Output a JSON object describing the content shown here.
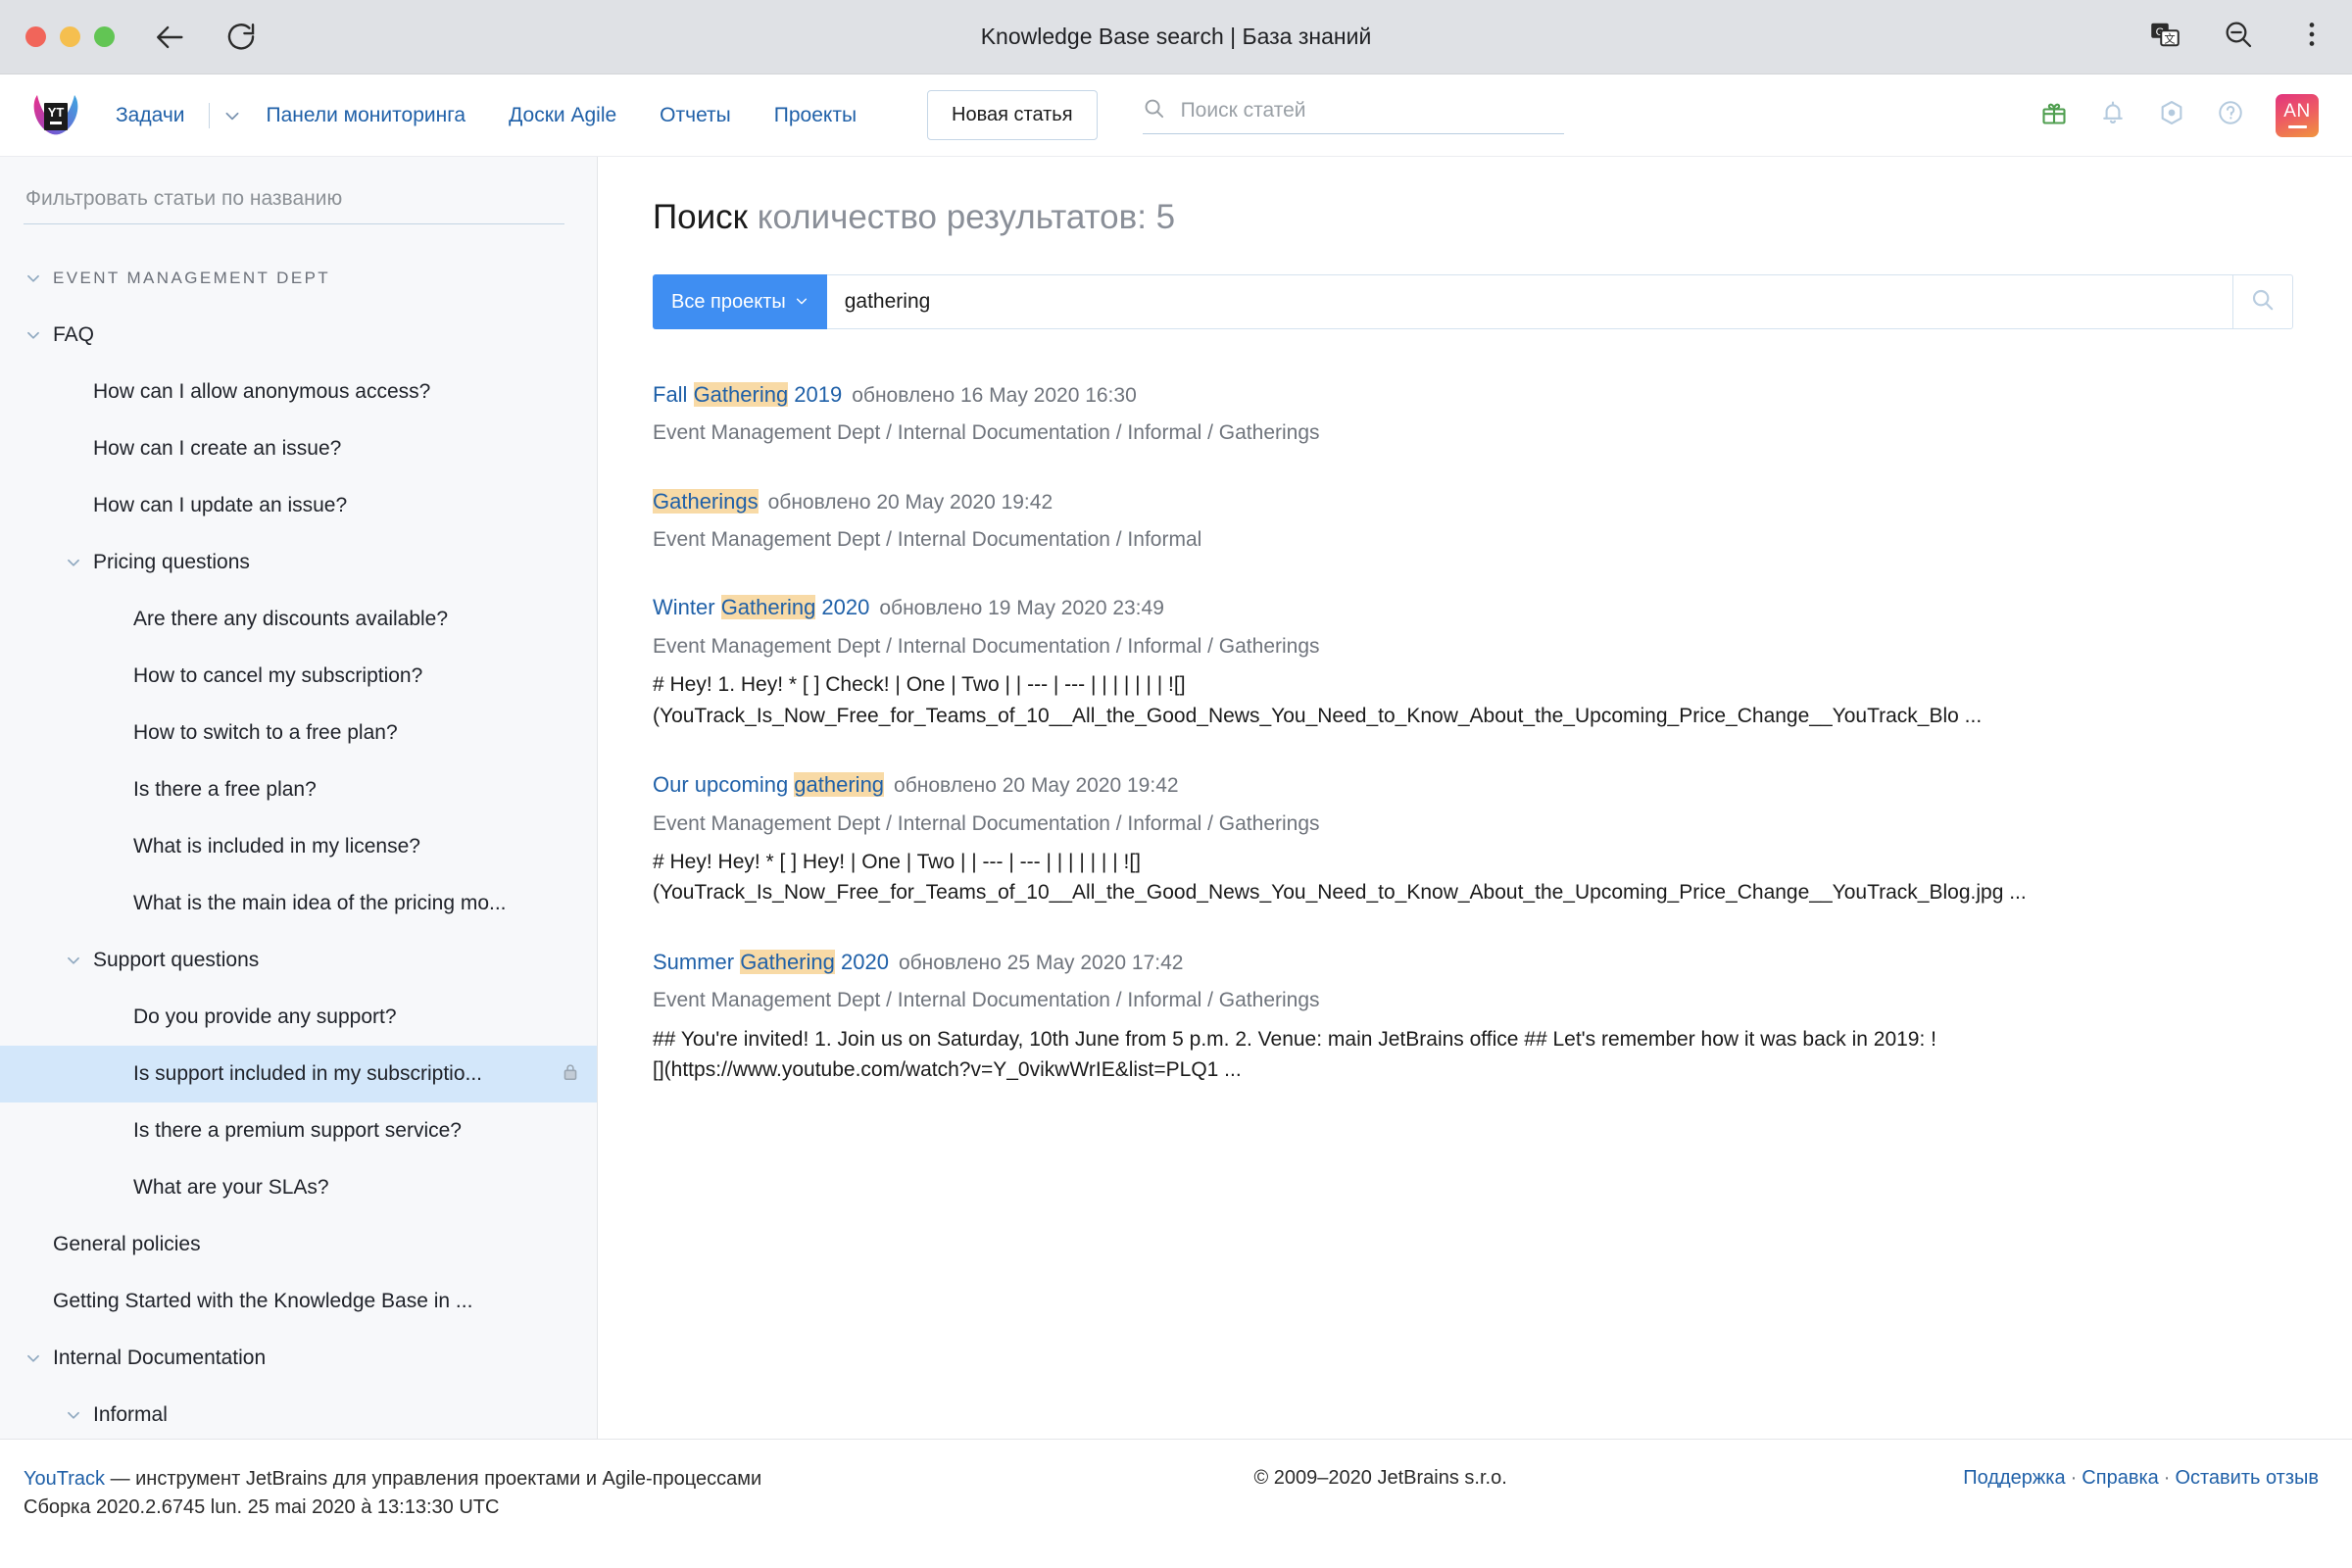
{
  "browser": {
    "page_title": "Knowledge Base search | База знаний",
    "back_icon": "back-arrow-icon",
    "reload_icon": "reload-icon",
    "translate_icon": "translate-icon",
    "zoom_out_icon": "zoom-out-icon",
    "menu_icon": "kebab-menu-icon"
  },
  "header": {
    "logo_text": "YT",
    "nav": [
      {
        "label": "Задачи",
        "has_caret": true
      },
      {
        "label": "Панели мониторинга",
        "has_caret": false
      },
      {
        "label": "Доски Agile",
        "has_caret": false
      },
      {
        "label": "Отчеты",
        "has_caret": false
      },
      {
        "label": "Проекты",
        "has_caret": false
      }
    ],
    "new_article_label": "Новая статья",
    "search_placeholder": "Поиск статей",
    "search_value": "",
    "icons": [
      "gift-icon",
      "bell-icon",
      "settings-hexagon-icon",
      "help-icon"
    ],
    "avatar_initials": "AN"
  },
  "sidebar": {
    "filter_placeholder": "Фильтровать статьи по названию",
    "filter_value": "",
    "tree": [
      {
        "label": "EVENT MANAGEMENT DEPT",
        "level": 0,
        "twisty": "down",
        "section": true,
        "selected": false,
        "lock": false
      },
      {
        "label": "FAQ",
        "level": 1,
        "twisty": "down",
        "section": false,
        "selected": false,
        "lock": false
      },
      {
        "label": "How can I allow anonymous access?",
        "level": 2,
        "twisty": "none",
        "section": false,
        "selected": false,
        "lock": false
      },
      {
        "label": "How can I create an issue?",
        "level": 2,
        "twisty": "none",
        "section": false,
        "selected": false,
        "lock": false
      },
      {
        "label": "How can I update an issue?",
        "level": 2,
        "twisty": "none",
        "section": false,
        "selected": false,
        "lock": false
      },
      {
        "label": "Pricing questions",
        "level": 2,
        "twisty": "down",
        "section": false,
        "selected": false,
        "lock": false
      },
      {
        "label": "Are there any discounts available?",
        "level": 3,
        "twisty": "none",
        "section": false,
        "selected": false,
        "lock": false
      },
      {
        "label": "How to cancel my subscription?",
        "level": 3,
        "twisty": "none",
        "section": false,
        "selected": false,
        "lock": false
      },
      {
        "label": "How to switch to a free plan?",
        "level": 3,
        "twisty": "none",
        "section": false,
        "selected": false,
        "lock": false
      },
      {
        "label": "Is there a free plan?",
        "level": 3,
        "twisty": "none",
        "section": false,
        "selected": false,
        "lock": false
      },
      {
        "label": "What is included in my license?",
        "level": 3,
        "twisty": "none",
        "section": false,
        "selected": false,
        "lock": false
      },
      {
        "label": "What is the main idea of the pricing mo...",
        "level": 3,
        "twisty": "none",
        "section": false,
        "selected": false,
        "lock": false
      },
      {
        "label": "Support questions",
        "level": 2,
        "twisty": "down",
        "section": false,
        "selected": false,
        "lock": false
      },
      {
        "label": "Do you provide any support?",
        "level": 3,
        "twisty": "none",
        "section": false,
        "selected": false,
        "lock": false
      },
      {
        "label": "Is support included in my subscriptio...",
        "level": 3,
        "twisty": "none",
        "section": false,
        "selected": true,
        "lock": true
      },
      {
        "label": "Is there a premium support service?",
        "level": 3,
        "twisty": "none",
        "section": false,
        "selected": false,
        "lock": false
      },
      {
        "label": "What are your SLAs?",
        "level": 3,
        "twisty": "none",
        "section": false,
        "selected": false,
        "lock": false
      },
      {
        "label": "General policies",
        "level": 1,
        "twisty": "none",
        "section": false,
        "selected": false,
        "lock": false
      },
      {
        "label": "Getting Started with the Knowledge Base in ...",
        "level": 1,
        "twisty": "none",
        "section": false,
        "selected": false,
        "lock": false
      },
      {
        "label": "Internal Documentation",
        "level": 1,
        "twisty": "down",
        "section": false,
        "selected": false,
        "lock": false
      },
      {
        "label": "Informal",
        "level": 2,
        "twisty": "down",
        "section": false,
        "selected": false,
        "lock": false
      }
    ]
  },
  "main": {
    "title_prefix": "Поиск",
    "title_count": "количество результатов: 5",
    "project_filter_label": "Все проекты",
    "query_value": "gathering",
    "query_placeholder": "",
    "search_button_icon": "search-icon",
    "results": [
      {
        "title_before": "Fall ",
        "title_highlight": "Gathering",
        "title_after": " 2019",
        "meta": "обновлено 16 May 2020 16:30",
        "path": "Event Management Dept / Internal Documentation / Informal / Gatherings",
        "snippet_lines": []
      },
      {
        "title_before": "",
        "title_highlight": "Gatherings",
        "title_after": "",
        "meta": "обновлено 20 May 2020 19:42",
        "path": "Event Management Dept / Internal Documentation / Informal",
        "snippet_lines": []
      },
      {
        "title_before": "Winter ",
        "title_highlight": "Gathering",
        "title_after": " 2020",
        "meta": "обновлено 19 May 2020 23:49",
        "path": "Event Management Dept / Internal Documentation / Informal / Gatherings",
        "snippet_lines": [
          "# Hey! 1. Hey! * [ ] Check! | One | Two | | --- | --- | | | | | | | ![]",
          "(YouTrack_Is_Now_Free_for_Teams_of_10__All_the_Good_News_You_Need_to_Know_About_the_Upcoming_Price_Change__YouTrack_Blo ..."
        ]
      },
      {
        "title_before": "Our upcoming ",
        "title_highlight": "gathering",
        "title_after": "",
        "meta": "обновлено 20 May 2020 19:42",
        "path": "Event Management Dept / Internal Documentation / Informal / Gatherings",
        "snippet_lines": [
          "# Hey! Hey! * [ ] Hey! | One | Two | | --- | --- | | | | | | | ![]",
          "(YouTrack_Is_Now_Free_for_Teams_of_10__All_the_Good_News_You_Need_to_Know_About_the_Upcoming_Price_Change__YouTrack_Blog.jpg ..."
        ]
      },
      {
        "title_before": "Summer ",
        "title_highlight": "Gathering",
        "title_after": " 2020",
        "meta": "обновлено 25 May 2020 17:42",
        "path": "Event Management Dept / Internal Documentation / Informal / Gatherings",
        "snippet_lines": [
          "## You're invited! 1. Join us on Saturday, 10th June from 5 p.m. 2. Venue: main JetBrains office ## Let's remember how it was back in 2019: !",
          "[](https://www.youtube.com/watch?v=Y_0vikwWrIE&list=PLQ1 ..."
        ]
      }
    ]
  },
  "footer": {
    "product_link": "YouTrack",
    "tagline": " — инструмент JetBrains для управления проектами и Agile-процессами",
    "build": "Сборка 2020.2.6745 lun. 25 mai 2020 à 13:13:30 UTC",
    "copyright": "© 2009–2020 JetBrains s.r.o.",
    "links": [
      "Поддержка",
      "Справка",
      "Оставить отзыв"
    ]
  }
}
